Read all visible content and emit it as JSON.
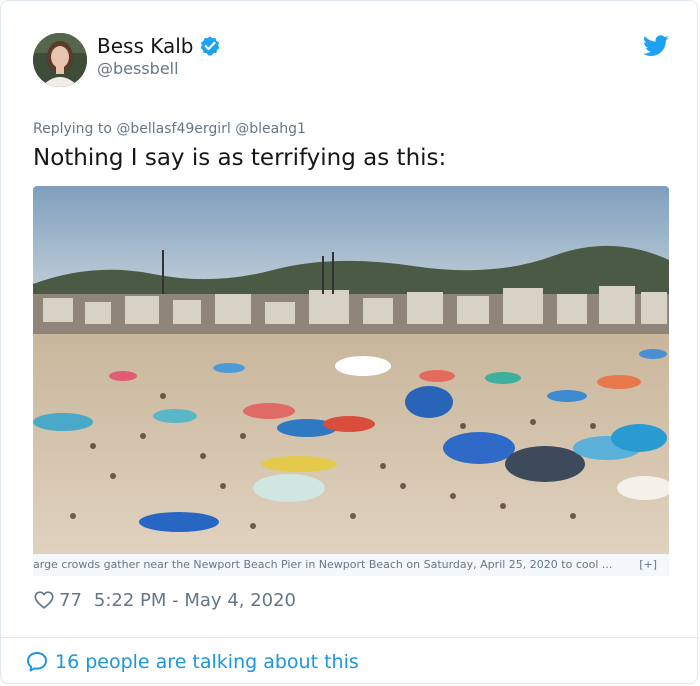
{
  "author": {
    "display_name": "Bess Kalb",
    "handle": "@bessbell",
    "verified": true,
    "avatar_icon": "avatar-photo"
  },
  "platform_icon": "twitter-bird-icon",
  "tweet": {
    "replying_to": "Replying to @bellasf49ergirl @bleahg1",
    "text": "Nothing I say is as terrifying as this:",
    "media_caption": "arge crowds gather near the Newport Beach Pier in Newport Beach on Saturday, April 25, 2020 to cool ...",
    "media_caption_more": "[+]"
  },
  "meta": {
    "likes": "77",
    "timestamp": "5:22 PM - May 4, 2020"
  },
  "footer": {
    "talking": "16 people are talking about this"
  },
  "colors": {
    "accent": "#1da1f2",
    "link": "#1b95e0",
    "muted": "#657786",
    "text": "#14171a"
  }
}
